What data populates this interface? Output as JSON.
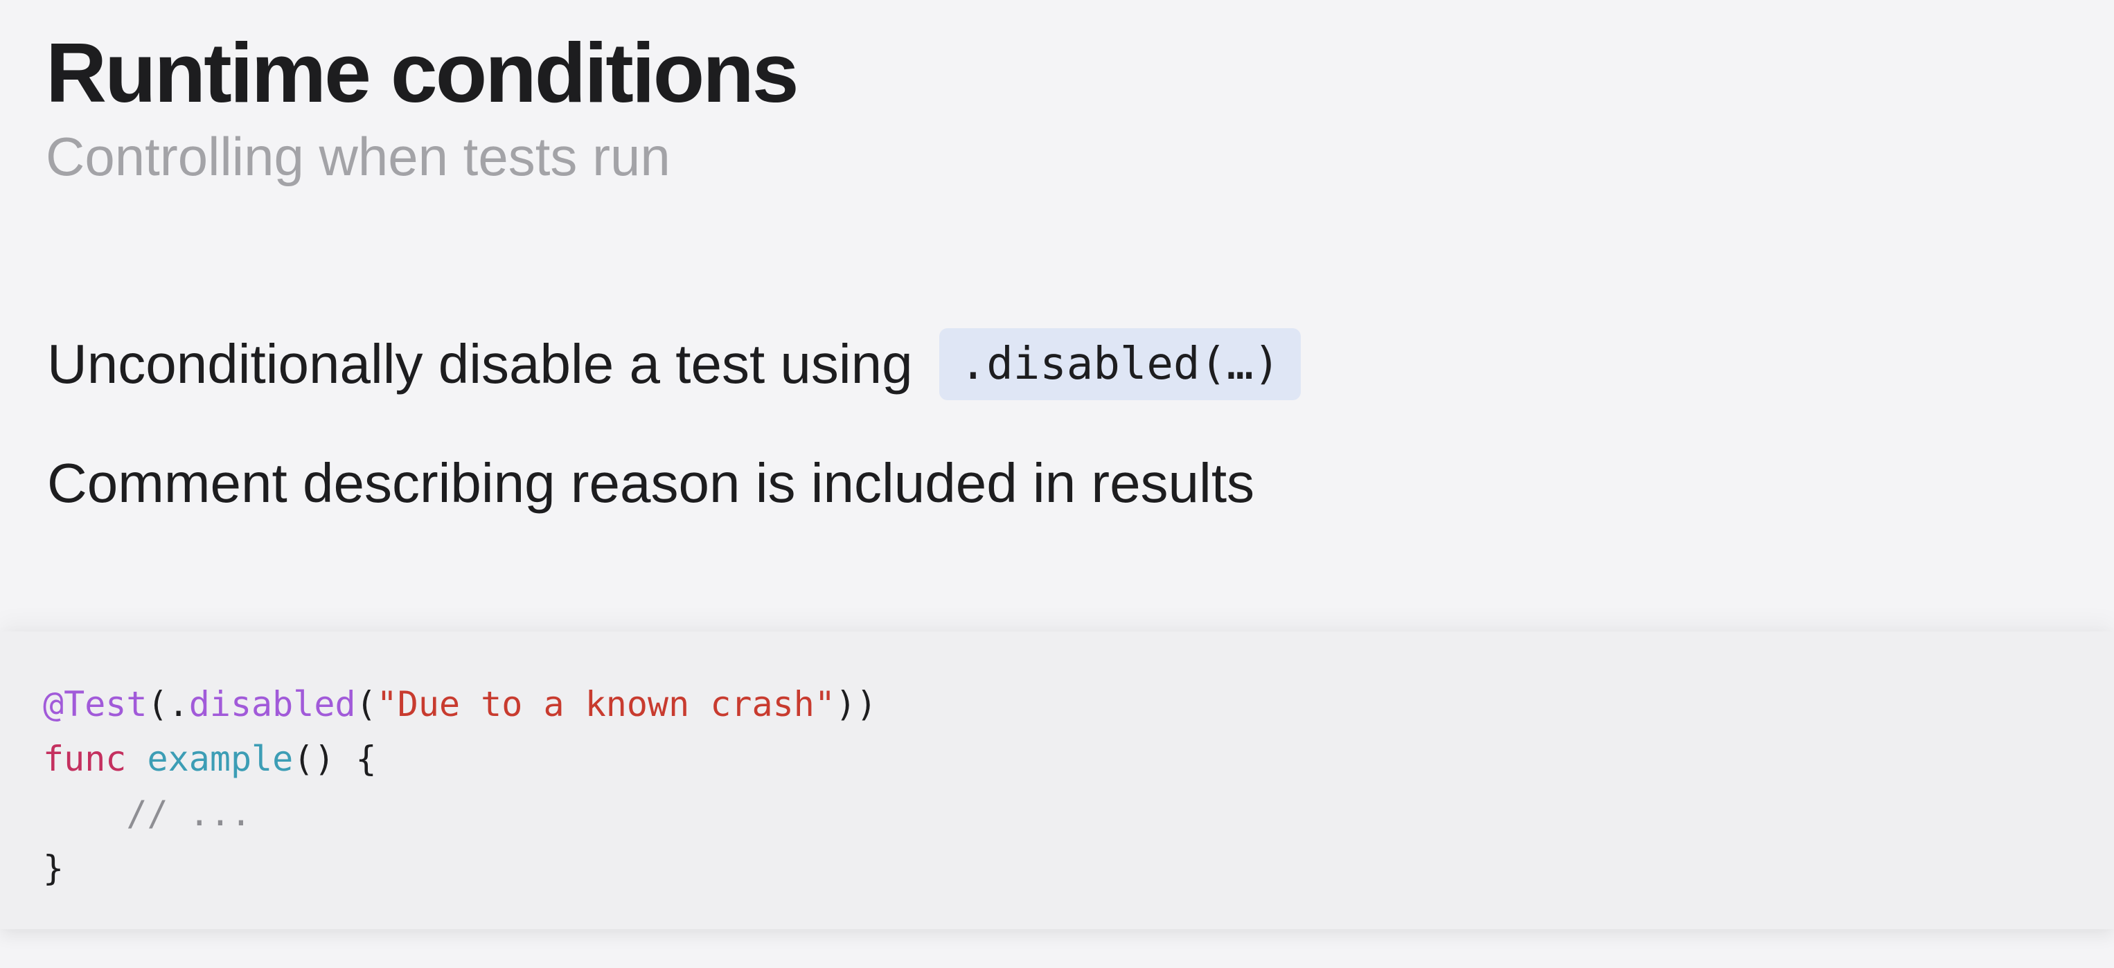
{
  "slide": {
    "title": "Runtime conditions",
    "subtitle": "Controlling when tests run"
  },
  "bullets": [
    {
      "text": "Unconditionally disable a test using",
      "code": ".disabled(…)"
    },
    {
      "text": "Comment describing reason is included in results"
    }
  ],
  "code_sample": {
    "line1": {
      "at_test": "@Test",
      "open": "(.",
      "disabled": "disabled",
      "paren": "(",
      "string": "\"Due to a known crash\"",
      "close": "))"
    },
    "line2": {
      "func": "func",
      "space": " ",
      "name": "example",
      "rest": "() {"
    },
    "line3": {
      "indent": "    ",
      "comment": "// ..."
    },
    "line4": {
      "brace": "}"
    }
  },
  "colors": {
    "background": "#f4f4f6",
    "code_panel": "#efeff1",
    "inline_code_bg": "#dfe6f5",
    "attribute": "#a15ad9",
    "string": "#c83b2f",
    "keyword": "#c4305f",
    "function_name": "#3c9db5",
    "comment": "#8e8e93"
  }
}
